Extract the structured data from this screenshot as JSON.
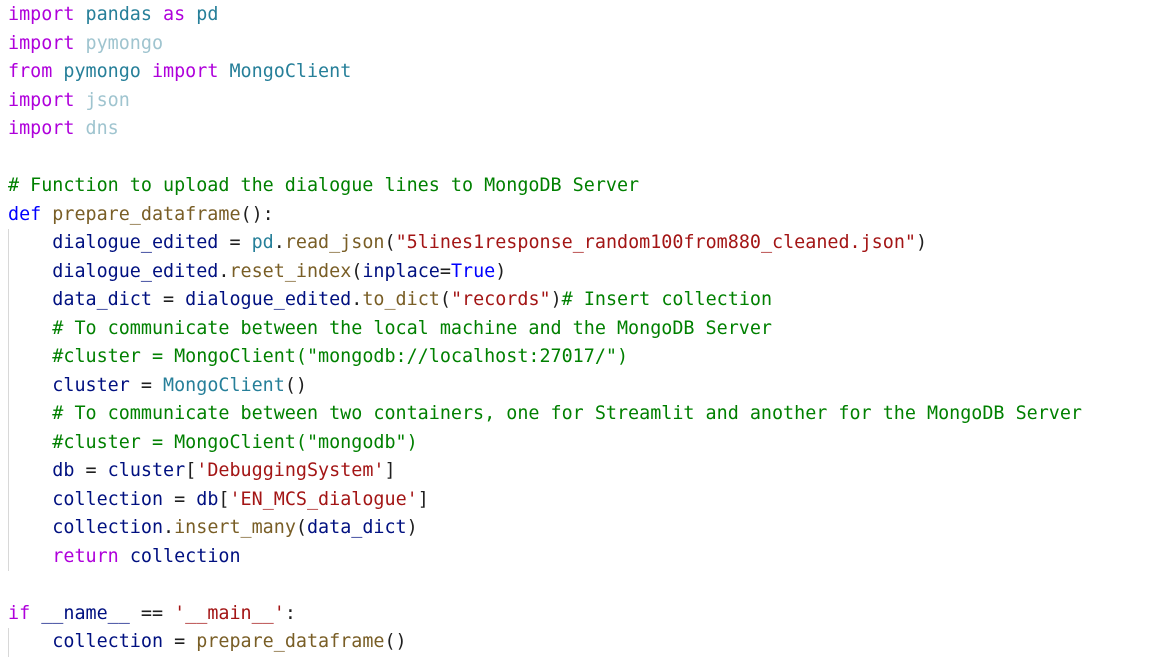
{
  "colors": {
    "keyword": "#af00db",
    "control": "#af00db",
    "def_keyword": "#0000ff",
    "function": "#795e26",
    "module": "#267f99",
    "unused_module": "#9fc4cf",
    "variable": "#001080",
    "string": "#a31515",
    "comment": "#008000",
    "constant": "#0000ff",
    "plain": "#1f1f1f",
    "indent_guide": "#d8d8d8"
  },
  "lines": [
    {
      "indent": 0,
      "guide": false,
      "tokens": [
        {
          "t": "import",
          "c": "keyword"
        },
        {
          "t": " ",
          "c": "plain"
        },
        {
          "t": "pandas",
          "c": "module"
        },
        {
          "t": " ",
          "c": "plain"
        },
        {
          "t": "as",
          "c": "keyword"
        },
        {
          "t": " ",
          "c": "plain"
        },
        {
          "t": "pd",
          "c": "module"
        }
      ]
    },
    {
      "indent": 0,
      "guide": false,
      "tokens": [
        {
          "t": "import",
          "c": "keyword"
        },
        {
          "t": " ",
          "c": "plain"
        },
        {
          "t": "pymongo",
          "c": "unused_module"
        }
      ]
    },
    {
      "indent": 0,
      "guide": false,
      "tokens": [
        {
          "t": "from",
          "c": "keyword"
        },
        {
          "t": " ",
          "c": "plain"
        },
        {
          "t": "pymongo",
          "c": "module"
        },
        {
          "t": " ",
          "c": "plain"
        },
        {
          "t": "import",
          "c": "keyword"
        },
        {
          "t": " ",
          "c": "plain"
        },
        {
          "t": "MongoClient",
          "c": "module"
        }
      ]
    },
    {
      "indent": 0,
      "guide": false,
      "tokens": [
        {
          "t": "import",
          "c": "keyword"
        },
        {
          "t": " ",
          "c": "plain"
        },
        {
          "t": "json",
          "c": "unused_module"
        }
      ]
    },
    {
      "indent": 0,
      "guide": false,
      "tokens": [
        {
          "t": "import",
          "c": "keyword"
        },
        {
          "t": " ",
          "c": "plain"
        },
        {
          "t": "dns",
          "c": "unused_module"
        }
      ]
    },
    {
      "indent": 0,
      "guide": false,
      "tokens": []
    },
    {
      "indent": 0,
      "guide": false,
      "tokens": [
        {
          "t": "# Function to upload the dialogue lines to MongoDB Server",
          "c": "comment"
        }
      ]
    },
    {
      "indent": 0,
      "guide": false,
      "tokens": [
        {
          "t": "def",
          "c": "def_keyword"
        },
        {
          "t": " ",
          "c": "plain"
        },
        {
          "t": "prepare_dataframe",
          "c": "function"
        },
        {
          "t": "():",
          "c": "plain"
        }
      ]
    },
    {
      "indent": 4,
      "guide": true,
      "tokens": [
        {
          "t": "dialogue_edited",
          "c": "variable"
        },
        {
          "t": " = ",
          "c": "plain"
        },
        {
          "t": "pd",
          "c": "module"
        },
        {
          "t": ".",
          "c": "plain"
        },
        {
          "t": "read_json",
          "c": "function"
        },
        {
          "t": "(",
          "c": "plain"
        },
        {
          "t": "\"5lines1response_random100from880_cleaned.json\"",
          "c": "string"
        },
        {
          "t": ")",
          "c": "plain"
        }
      ]
    },
    {
      "indent": 4,
      "guide": true,
      "tokens": [
        {
          "t": "dialogue_edited",
          "c": "variable"
        },
        {
          "t": ".",
          "c": "plain"
        },
        {
          "t": "reset_index",
          "c": "function"
        },
        {
          "t": "(",
          "c": "plain"
        },
        {
          "t": "inplace",
          "c": "variable"
        },
        {
          "t": "=",
          "c": "plain"
        },
        {
          "t": "True",
          "c": "constant"
        },
        {
          "t": ")",
          "c": "plain"
        }
      ]
    },
    {
      "indent": 4,
      "guide": true,
      "tokens": [
        {
          "t": "data_dict",
          "c": "variable"
        },
        {
          "t": " = ",
          "c": "plain"
        },
        {
          "t": "dialogue_edited",
          "c": "variable"
        },
        {
          "t": ".",
          "c": "plain"
        },
        {
          "t": "to_dict",
          "c": "function"
        },
        {
          "t": "(",
          "c": "plain"
        },
        {
          "t": "\"records\"",
          "c": "string"
        },
        {
          "t": ")",
          "c": "plain"
        },
        {
          "t": "# Insert collection",
          "c": "comment"
        }
      ]
    },
    {
      "indent": 4,
      "guide": true,
      "tokens": [
        {
          "t": "# To communicate between the local machine and the MongoDB Server",
          "c": "comment"
        }
      ]
    },
    {
      "indent": 4,
      "guide": true,
      "tokens": [
        {
          "t": "#cluster = MongoClient(\"mongodb://localhost:27017/\")",
          "c": "comment"
        }
      ]
    },
    {
      "indent": 4,
      "guide": true,
      "tokens": [
        {
          "t": "cluster",
          "c": "variable"
        },
        {
          "t": " = ",
          "c": "plain"
        },
        {
          "t": "MongoClient",
          "c": "module"
        },
        {
          "t": "()",
          "c": "plain"
        }
      ]
    },
    {
      "indent": 4,
      "guide": true,
      "tokens": [
        {
          "t": "# To communicate between two containers, one for Streamlit and another for the MongoDB Server",
          "c": "comment"
        }
      ]
    },
    {
      "indent": 4,
      "guide": true,
      "tokens": [
        {
          "t": "#cluster = MongoClient(\"mongodb\")",
          "c": "comment"
        }
      ]
    },
    {
      "indent": 4,
      "guide": true,
      "tokens": [
        {
          "t": "db",
          "c": "variable"
        },
        {
          "t": " = ",
          "c": "plain"
        },
        {
          "t": "cluster",
          "c": "variable"
        },
        {
          "t": "[",
          "c": "plain"
        },
        {
          "t": "'DebuggingSystem'",
          "c": "string"
        },
        {
          "t": "]",
          "c": "plain"
        }
      ]
    },
    {
      "indent": 4,
      "guide": true,
      "tokens": [
        {
          "t": "collection",
          "c": "variable"
        },
        {
          "t": " = ",
          "c": "plain"
        },
        {
          "t": "db",
          "c": "variable"
        },
        {
          "t": "[",
          "c": "plain"
        },
        {
          "t": "'EN_MCS_dialogue'",
          "c": "string"
        },
        {
          "t": "]",
          "c": "plain"
        }
      ]
    },
    {
      "indent": 4,
      "guide": true,
      "tokens": [
        {
          "t": "collection",
          "c": "variable"
        },
        {
          "t": ".",
          "c": "plain"
        },
        {
          "t": "insert_many",
          "c": "function"
        },
        {
          "t": "(",
          "c": "plain"
        },
        {
          "t": "data_dict",
          "c": "variable"
        },
        {
          "t": ")",
          "c": "plain"
        }
      ]
    },
    {
      "indent": 4,
      "guide": true,
      "tokens": [
        {
          "t": "return",
          "c": "control"
        },
        {
          "t": " ",
          "c": "plain"
        },
        {
          "t": "collection",
          "c": "variable"
        }
      ]
    },
    {
      "indent": 0,
      "guide": false,
      "tokens": []
    },
    {
      "indent": 0,
      "guide": false,
      "tokens": [
        {
          "t": "if",
          "c": "control"
        },
        {
          "t": " ",
          "c": "plain"
        },
        {
          "t": "__name__",
          "c": "variable"
        },
        {
          "t": " == ",
          "c": "plain"
        },
        {
          "t": "'__main__'",
          "c": "string"
        },
        {
          "t": ":",
          "c": "plain"
        }
      ]
    },
    {
      "indent": 4,
      "guide": true,
      "tokens": [
        {
          "t": "collection",
          "c": "variable"
        },
        {
          "t": " = ",
          "c": "plain"
        },
        {
          "t": "prepare_dataframe",
          "c": "function"
        },
        {
          "t": "()",
          "c": "plain"
        }
      ]
    }
  ]
}
